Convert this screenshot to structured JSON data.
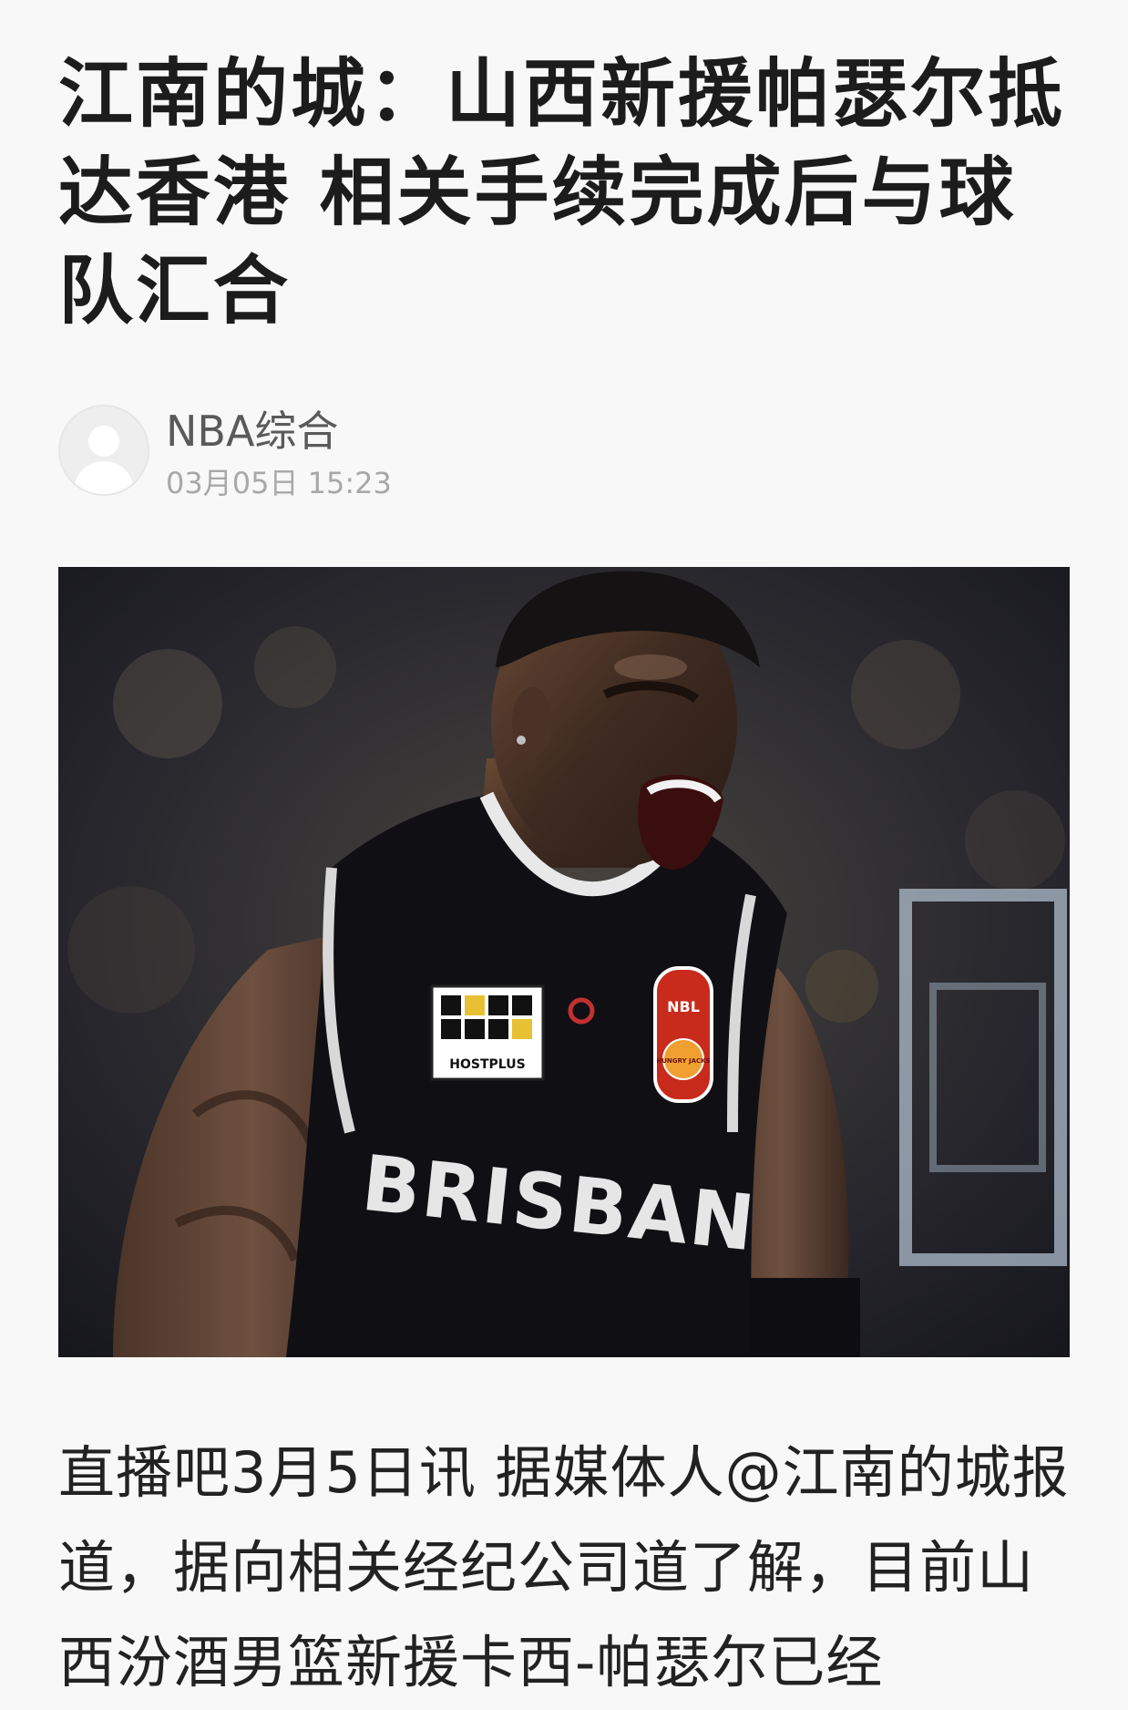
{
  "article": {
    "title": "江南的城：山西新援帕瑟尔抵达香港 相关手续完成后与球队汇合",
    "author": {
      "name": "NBA综合",
      "time": "03月05日 15:23",
      "avatar_icon": "default-user-avatar-icon"
    },
    "image": {
      "jersey_text": "BRISBAN",
      "sponsor_text": "HOSTPLUS",
      "badge_text": "NBL",
      "badge_sub_text": "HUNGRY JACKS"
    },
    "body": "直播吧3月5日讯 据媒体人@江南的城报道，据向相关经纪公司道了解，目前山西汾酒男篮新援卡西-帕瑟尔已经"
  },
  "colors": {
    "background": "#f8f8f8",
    "title": "#1c1c1c",
    "author_name": "#5a5a5a",
    "time": "#a8a8a8",
    "body": "#222222"
  }
}
